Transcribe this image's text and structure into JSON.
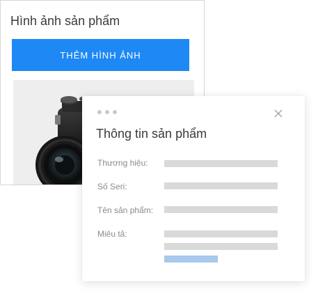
{
  "images_panel": {
    "title": "Hình ảnh sản phẩm",
    "add_button_label": "THÊM HÌNH ẢNH",
    "button_color": "#1e88f5"
  },
  "info_panel": {
    "title": "Thông tin sản phẩm",
    "fields": [
      {
        "label": "Thương hiệu:"
      },
      {
        "label": "Số Seri:"
      },
      {
        "label": "Tên sản phẩm:"
      },
      {
        "label": "Miêu tả:"
      }
    ],
    "placeholder_color": "#d9d9d9",
    "accent_placeholder_color": "#a8c8ec"
  },
  "icons": {
    "window_dots": "three-dots-icon",
    "close": "close-icon",
    "photo": "camera-photo"
  }
}
